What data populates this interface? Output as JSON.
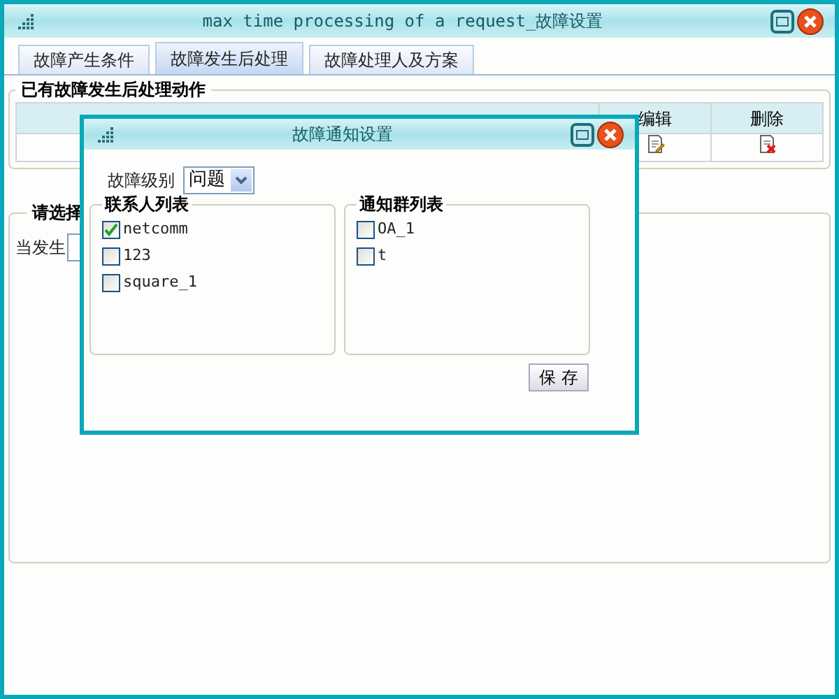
{
  "window": {
    "title": "max time processing of a request_故障设置"
  },
  "tabs": [
    {
      "label": "故障产生条件",
      "selected": false
    },
    {
      "label": "故障发生后处理",
      "selected": true
    },
    {
      "label": "故障处理人及方案",
      "selected": false
    }
  ],
  "actions_panel": {
    "legend": "已有故障发生后处理动作",
    "columns": [
      "编辑",
      "删除"
    ]
  },
  "select_panel": {
    "legend": "请选择",
    "trigger_label": "当发生"
  },
  "dialog": {
    "title": "故障通知设置",
    "level_label": "故障级别",
    "level_value": "问题",
    "contacts": {
      "legend": "联系人列表",
      "items": [
        {
          "label": "netcomm",
          "checked": true
        },
        {
          "label": "123",
          "checked": false
        },
        {
          "label": "square_1",
          "checked": false
        }
      ]
    },
    "groups": {
      "legend": "通知群列表",
      "items": [
        {
          "label": "OA_1",
          "checked": false
        },
        {
          "label": "t",
          "checked": false
        }
      ]
    },
    "save_button": "保 存"
  }
}
